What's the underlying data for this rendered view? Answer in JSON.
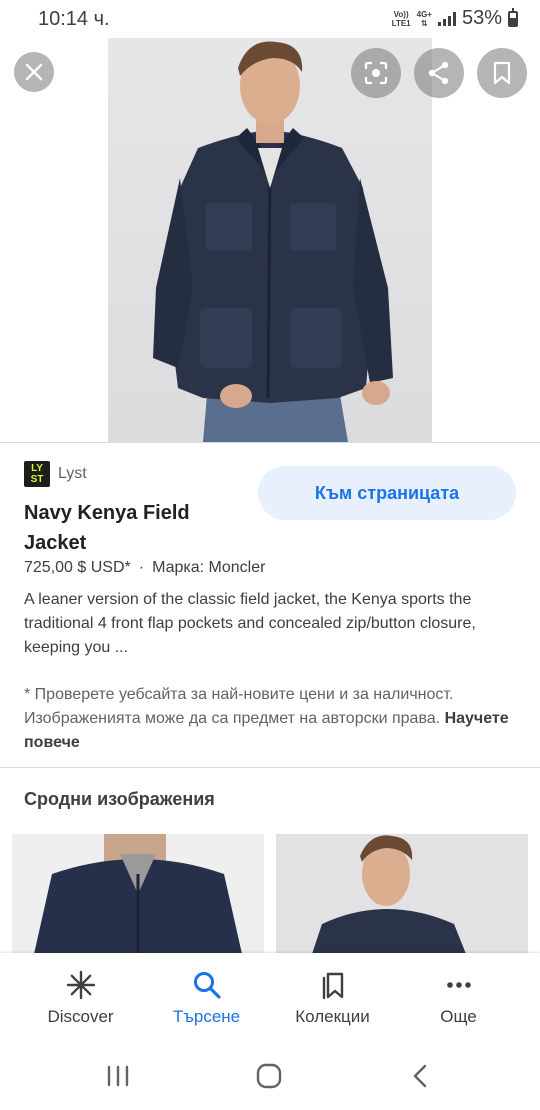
{
  "status_bar": {
    "time": "10:14 ч.",
    "network_top": "Vo))",
    "network_bottom": "LTE1",
    "net_type": "4G+",
    "battery": "53%",
    "battery_level": 0.53
  },
  "hero": {
    "close_icon": "close-icon",
    "lens_icon": "lens-icon",
    "share_icon": "share-icon",
    "bookmark_icon": "bookmark-icon"
  },
  "result": {
    "source_logo_line1": "LY",
    "source_logo_line2": "ST",
    "source_name": "Lyst",
    "visit_button": "Към страницата",
    "title": "Navy Kenya Field Jacket",
    "price": "725,00 $ USD*",
    "separator": "·",
    "brand": "Марка: Moncler",
    "description": "A leaner version of the classic field jacket, the Kenya sports the traditional 4 front flap pockets and concealed zip/button closure, keeping you ...",
    "note": "* Проверете уебсайта за най-новите цени и за наличност. Изображенията може да са предмет на авторски права.",
    "note_link": "Научете повече"
  },
  "related": {
    "title": "Сродни изображения"
  },
  "bottom_nav": {
    "items": [
      {
        "label": "Discover",
        "icon": "discover-icon"
      },
      {
        "label": "Търсене",
        "icon": "search-icon"
      },
      {
        "label": "Колекции",
        "icon": "collections-icon"
      },
      {
        "label": "Още",
        "icon": "more-icon"
      }
    ],
    "active_color": "#1a73e8"
  },
  "colors": {
    "accent": "#1a73e8",
    "button_bg": "#e8f0fe",
    "jacket": "#2a3347"
  }
}
